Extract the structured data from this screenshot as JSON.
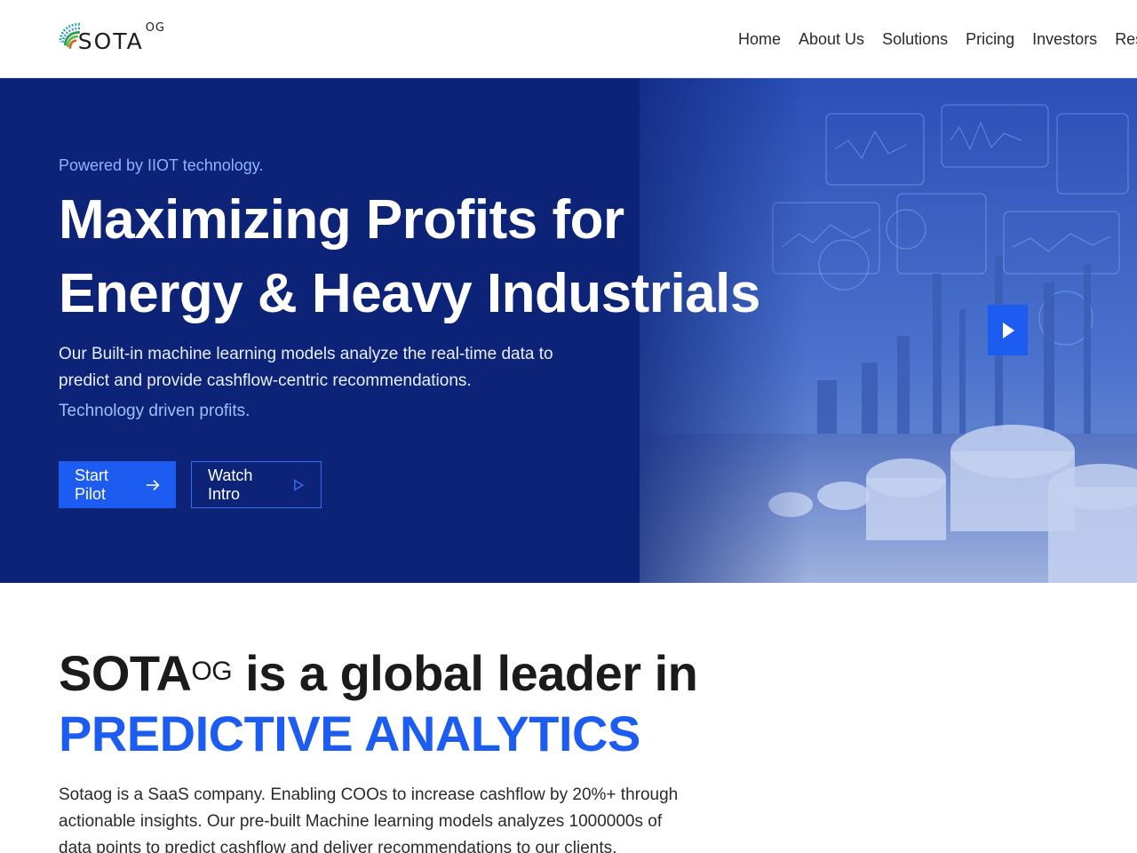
{
  "brand": {
    "name": "SOTA",
    "superscript": "OG"
  },
  "nav": {
    "items": [
      {
        "label": "Home"
      },
      {
        "label": "About Us"
      },
      {
        "label": "Solutions"
      },
      {
        "label": "Pricing"
      },
      {
        "label": "Investors"
      },
      {
        "label": "Resour"
      }
    ]
  },
  "hero": {
    "eyebrow": "Powered by IIOT technology.",
    "title_line1": "Maximizing Profits for",
    "title_line2": "Energy & Heavy Industrials",
    "description": "Our Built-in machine learning models analyze the real-time data to predict and provide cashflow-centric recommendations.",
    "tagline": "Technology driven profits.",
    "primary_button": "Start Pilot",
    "secondary_button": "Watch Intro"
  },
  "leader": {
    "brand": "SOTA",
    "brand_sup": "OG",
    "heading_rest": " is a global leader in",
    "accent": "PREDICTIVE ANALYTICS",
    "body": "Sotaog is a SaaS company. Enabling COOs to increase cashflow by 20%+ through actionable insights. Our pre-built Machine learning models analyzes 1000000s of data points to predict cashflow and deliver recommendations to our clients."
  },
  "colors": {
    "hero_bg": "#0c2377",
    "accent": "#1c5cf0",
    "eyebrow": "#8eb4ff"
  }
}
